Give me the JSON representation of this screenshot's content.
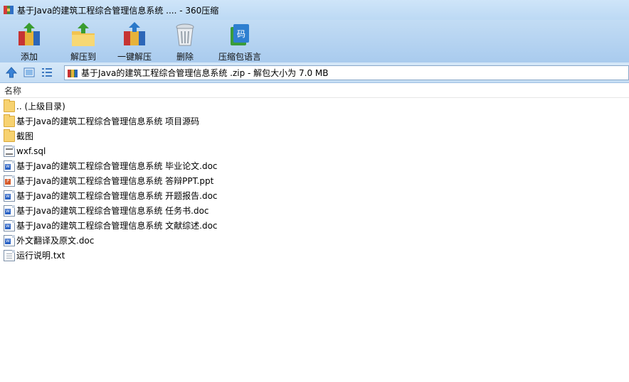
{
  "window": {
    "title": "基于Java的建筑工程综合管理信息系统 .... - 360压缩"
  },
  "toolbar": {
    "buttons": [
      {
        "label": "添加",
        "icon": "add-archive-icon"
      },
      {
        "label": "解压到",
        "icon": "extract-to-icon"
      },
      {
        "label": "一键解压",
        "icon": "one-click-extract-icon"
      },
      {
        "label": "删除",
        "icon": "delete-icon"
      },
      {
        "label": "压缩包语言",
        "icon": "archive-language-icon"
      }
    ]
  },
  "address_bar": {
    "path": "基于Java的建筑工程综合管理信息系统 .zip - 解包大小为 7.0 MB"
  },
  "list": {
    "column_header": "名称",
    "items": [
      {
        "name": ".. (上级目录)",
        "type": "folder"
      },
      {
        "name": "基于Java的建筑工程综合管理信息系统 项目源码",
        "type": "folder"
      },
      {
        "name": "截图",
        "type": "folder"
      },
      {
        "name": "wxf.sql",
        "type": "sql"
      },
      {
        "name": "基于Java的建筑工程综合管理信息系统 毕业论文.doc",
        "type": "doc"
      },
      {
        "name": "基于Java的建筑工程综合管理信息系统 答辩PPT.ppt",
        "type": "ppt"
      },
      {
        "name": "基于Java的建筑工程综合管理信息系统 开题报告.doc",
        "type": "doc"
      },
      {
        "name": "基于Java的建筑工程综合管理信息系统 任务书.doc",
        "type": "doc"
      },
      {
        "name": "基于Java的建筑工程综合管理信息系统 文献综述.doc",
        "type": "doc"
      },
      {
        "name": "外文翻译及原文.doc",
        "type": "doc"
      },
      {
        "name": "运行说明.txt",
        "type": "txt"
      }
    ]
  },
  "colors": {
    "titlebar": "#c6dff7",
    "toolbar": "#b5d3f1",
    "folder": "#f7d270",
    "word": "#2a62c4",
    "ppt": "#d55a2a"
  }
}
